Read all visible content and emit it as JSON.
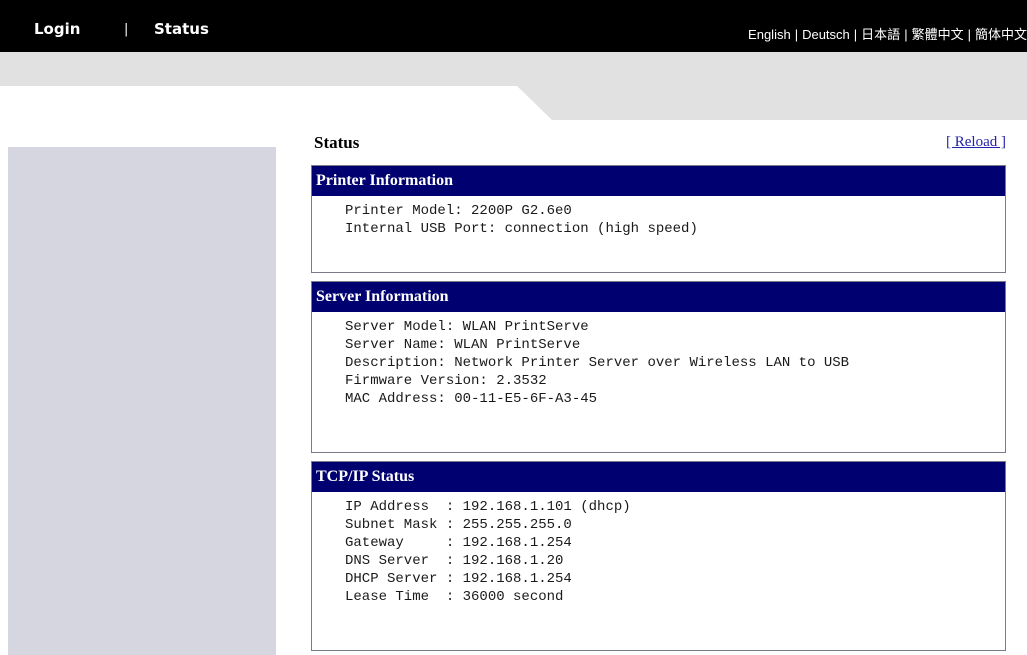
{
  "nav": {
    "login": "Login",
    "separator": "|",
    "status": "Status"
  },
  "languages": [
    "English",
    "Deutsch",
    "日本語",
    "繁體中文",
    "簡体中文"
  ],
  "page": {
    "title": "Status",
    "reload": "[ Reload ]"
  },
  "panels": {
    "printer": {
      "title": "Printer Information",
      "lines": [
        "Printer Model: 2200P G2.6e0",
        "Internal USB Port: connection (high speed)"
      ]
    },
    "server": {
      "title": "Server Information",
      "lines": [
        "Server Model: WLAN PrintServe",
        "Server Name: WLAN PrintServe",
        "Description: Network Printer Server over Wireless LAN to USB",
        "Firmware Version: 2.3532",
        "MAC Address: 00-11-E5-6F-A3-45"
      ]
    },
    "tcpip": {
      "title": "TCP/IP Status",
      "lines": [
        "IP Address  : 192.168.1.101 (dhcp)",
        "Subnet Mask : 255.255.255.0",
        "Gateway     : 192.168.1.254",
        "DNS Server  : 192.168.1.20",
        "DHCP Server : 192.168.1.254",
        "Lease Time  : 36000 second"
      ]
    }
  }
}
